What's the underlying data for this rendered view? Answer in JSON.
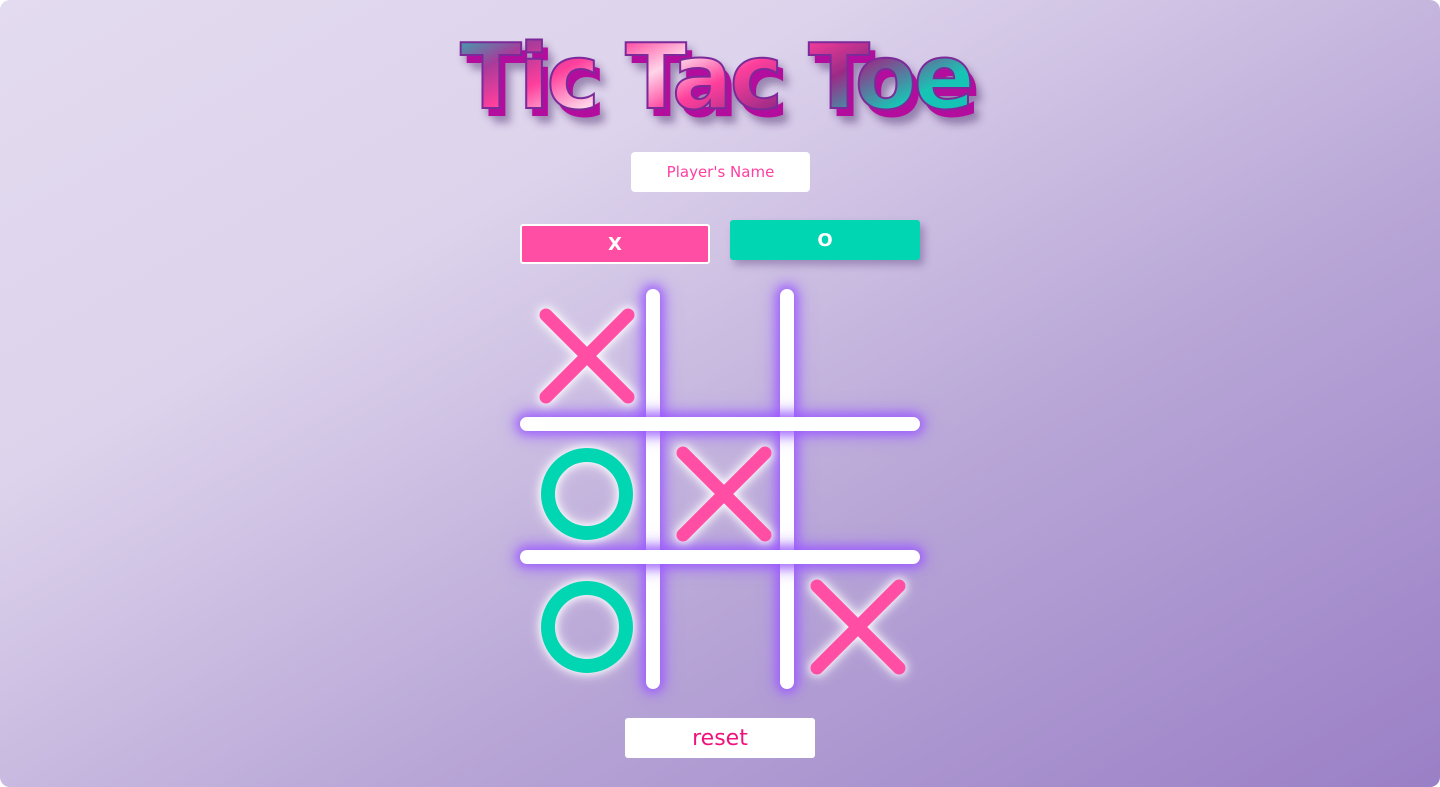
{
  "app": {
    "title": "Tic Tac Toe"
  },
  "player": {
    "name_value": "",
    "name_placeholder": "Player's Name"
  },
  "symbol_choice": {
    "x_label": "X",
    "o_label": "O"
  },
  "board": {
    "cells": [
      "X",
      "",
      "",
      "O",
      "X",
      "",
      "O",
      "",
      "X"
    ]
  },
  "controls": {
    "reset_label": "reset"
  },
  "colors": {
    "x_mark": "#ff4ea3",
    "o_mark": "#00d6b1",
    "grid_line": "#ffffff",
    "grid_glow": "#9650ff",
    "reset_text": "#f0127d"
  },
  "icons": {
    "x_mark": "x-mark-icon",
    "o_mark": "o-mark-icon"
  }
}
